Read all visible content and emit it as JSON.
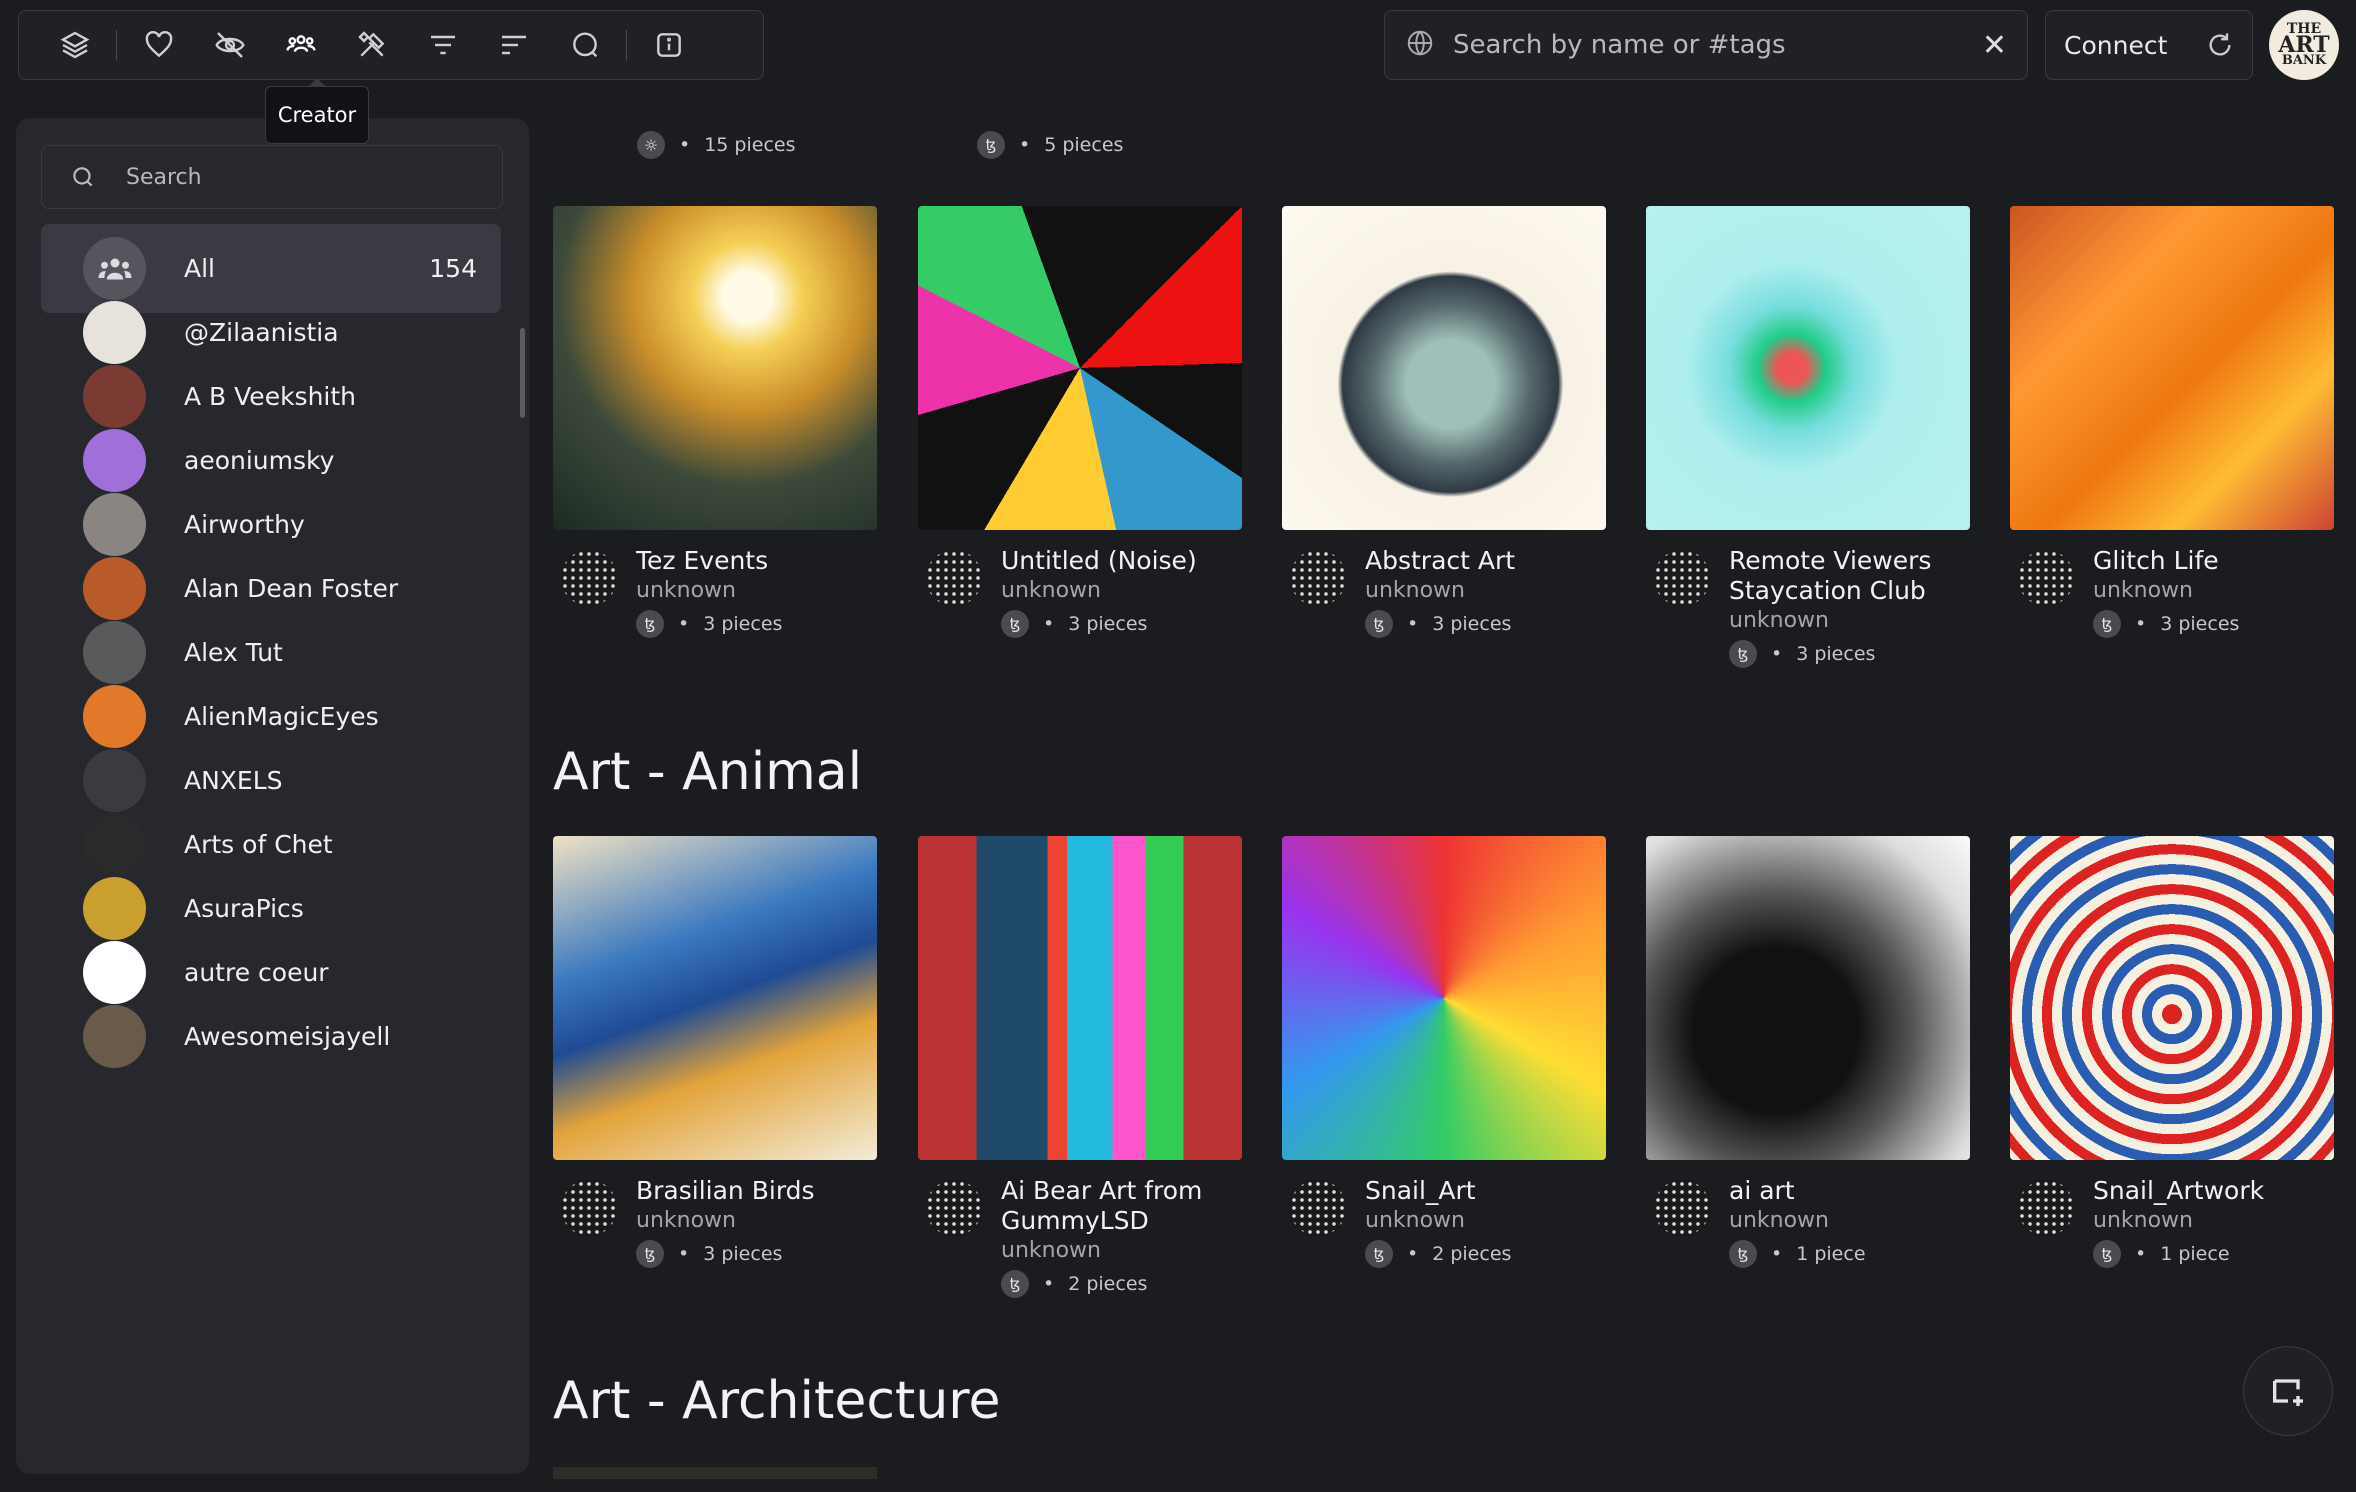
{
  "toolbar": {
    "tooltip": "Creator",
    "icons": [
      "layers-icon",
      "heart-icon",
      "eye-off-icon",
      "creator-icon",
      "tools-icon",
      "filter-icon",
      "sort-icon",
      "chat-icon",
      "info-icon"
    ]
  },
  "search": {
    "placeholder": "Search by name or #tags"
  },
  "connect": {
    "label": "Connect"
  },
  "logo": {
    "line1": "THE",
    "line2": "ART",
    "line3": "BANK"
  },
  "sidebar": {
    "search_placeholder": "Search",
    "all": {
      "label": "All",
      "count": "154"
    },
    "items": [
      {
        "label": "@Zilaanistia",
        "color": "#e8e2dc"
      },
      {
        "label": "A B Veekshith",
        "color": "#7a3b32"
      },
      {
        "label": "aeoniumsky",
        "color": "#a070d8"
      },
      {
        "label": "Airworthy",
        "color": "#8a8580"
      },
      {
        "label": "Alan Dean Foster",
        "color": "#b85a2a"
      },
      {
        "label": "Alex Tut",
        "color": "#5a5a5a"
      },
      {
        "label": "AlienMagicEyes",
        "color": "#e07a2a"
      },
      {
        "label": "ANXELS",
        "color": "#3a3a40"
      },
      {
        "label": "Arts of Chet",
        "color": "#2a2a2a"
      },
      {
        "label": "AsuraPics",
        "color": "#c9a030"
      },
      {
        "label": "autre coeur",
        "color": "#ffffff"
      },
      {
        "label": "Awesomeisjayell",
        "color": "#6a5a4a"
      }
    ]
  },
  "top_partial": [
    {
      "meta": "15 pieces"
    },
    {
      "meta": "5 pieces"
    }
  ],
  "sections": [
    {
      "cards": [
        {
          "title_lines": [
            "Tez Events"
          ],
          "author": "unknown",
          "pieces": "3 pieces"
        },
        {
          "title_lines": [
            "Untitled (Noise)"
          ],
          "author": "unknown",
          "pieces": "3 pieces"
        },
        {
          "title_lines": [
            "Abstract Art"
          ],
          "author": "unknown",
          "pieces": "3 pieces"
        },
        {
          "title_lines": [
            "Remote Viewers",
            "Staycation Club"
          ],
          "author": "unknown",
          "pieces": "3 pieces"
        },
        {
          "title_lines": [
            "Glitch Life"
          ],
          "author": "unknown",
          "pieces": "3 pieces"
        }
      ]
    },
    {
      "title": "Art - Animal",
      "cards": [
        {
          "title_lines": [
            "Brasilian Birds"
          ],
          "author": "unknown",
          "pieces": "3 pieces"
        },
        {
          "title_lines": [
            "Ai Bear Art from",
            "GummyLSD"
          ],
          "author": "unknown",
          "pieces": "2 pieces"
        },
        {
          "title_lines": [
            "Snail_Art"
          ],
          "author": "unknown",
          "pieces": "2 pieces"
        },
        {
          "title_lines": [
            "ai art"
          ],
          "author": "unknown",
          "pieces": "1 piece"
        },
        {
          "title_lines": [
            "Snail_Artwork"
          ],
          "author": "unknown",
          "pieces": "1 piece"
        }
      ]
    },
    {
      "title": "Art - Architecture"
    }
  ],
  "tezos_symbol": "ꜩ"
}
